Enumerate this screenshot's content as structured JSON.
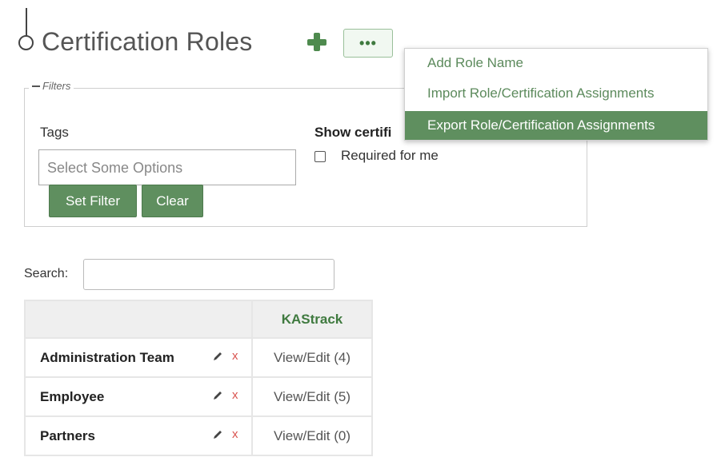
{
  "header": {
    "title": "Certification Roles",
    "more_label": "•••"
  },
  "more_menu": {
    "items": [
      {
        "label": "Add Role Name"
      },
      {
        "label": "Import Role/Certification Assignments"
      },
      {
        "label": "Export Role/Certification Assignments"
      }
    ],
    "highlighted_index": 2
  },
  "filters": {
    "legend": "Filters",
    "tags_label": "Tags",
    "tags_placeholder": "Select Some Options",
    "set_filter_label": "Set Filter",
    "clear_label": "Clear",
    "show_cert_label": "Show certifi",
    "required_label": "Required for me",
    "required_checked": false
  },
  "search": {
    "label": "Search:",
    "value": ""
  },
  "table": {
    "columns": [
      "",
      "KAStrack"
    ],
    "rows": [
      {
        "role": "Administration Team",
        "kastrack": "View/Edit (4)"
      },
      {
        "role": "Employee",
        "kastrack": "View/Edit (5)"
      },
      {
        "role": "Partners",
        "kastrack": "View/Edit (0)"
      }
    ],
    "delete_glyph": "x"
  },
  "colors": {
    "accent_green": "#5f8f5f",
    "link_green": "#5c8a5c",
    "delete_red": "#d9534f"
  },
  "icons": {
    "add": "plus-icon",
    "more": "ellipsis-icon",
    "edit": "pencil-icon",
    "delete": "x-icon",
    "collapse": "minus-icon"
  }
}
